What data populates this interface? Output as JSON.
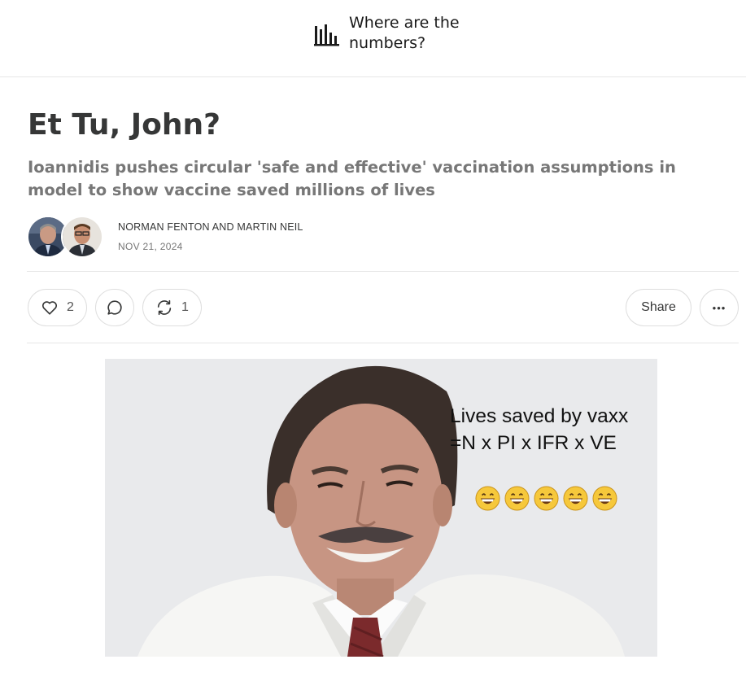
{
  "publication": {
    "name": "Where are the numbers?",
    "logo_icon": "bar-chart-icon"
  },
  "post": {
    "title": "Et Tu, John?",
    "subtitle": "Ioannidis pushes circular 'safe and effective' vaccination assumptions in model to show vaccine saved millions of lives",
    "authors": "Norman Fenton and Martin Neil",
    "date": "Nov 21, 2024"
  },
  "actions": {
    "like_count": "2",
    "restack_count": "1",
    "share_label": "Share",
    "more_label": "•••"
  },
  "hero_image": {
    "caption_line1": "Lives saved by vaxx",
    "caption_line2": "=N x PI x IFR x VE",
    "emoji_icon": "grinning-face-icon",
    "emoji_count": 5
  },
  "colors": {
    "text": "#363737",
    "muted": "#777777",
    "border": "#e6e6e6",
    "hero_bg": "#e9eaec"
  }
}
